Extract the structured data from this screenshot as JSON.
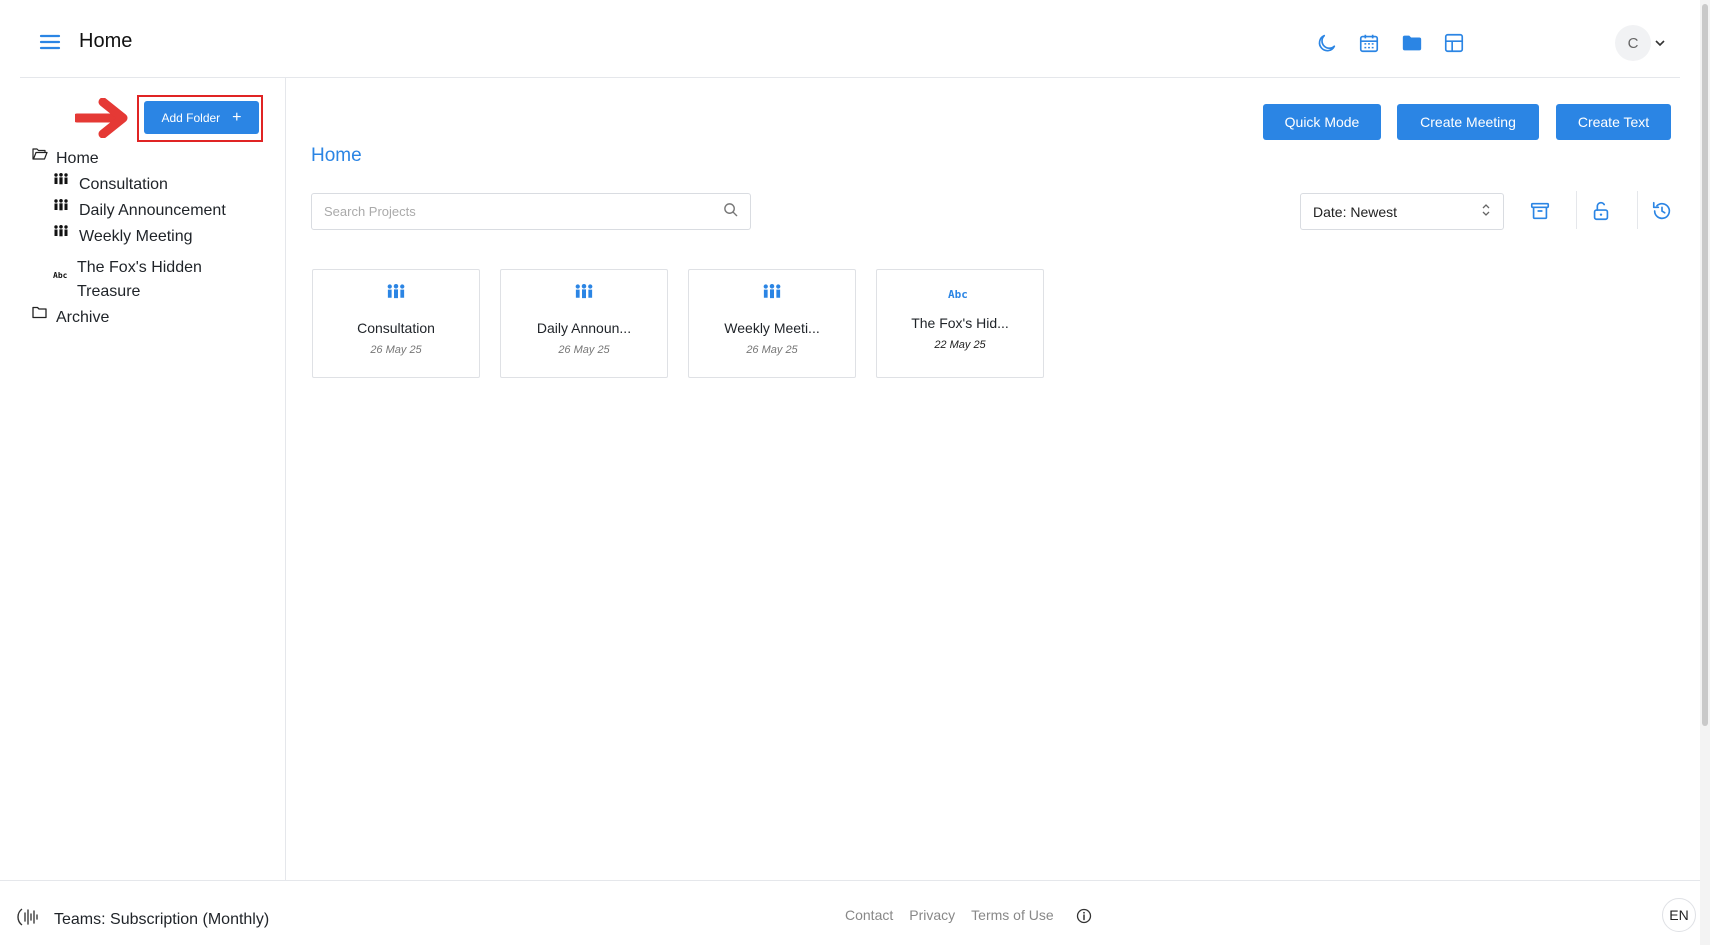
{
  "header": {
    "title": "Home",
    "avatar_initial": "C"
  },
  "sidebar": {
    "add_folder_label": "Add Folder",
    "add_folder_plus": "+",
    "tree": [
      {
        "label": "Home",
        "icon": "folder-open-icon"
      },
      {
        "label": "Consultation",
        "icon": "meeting-icon"
      },
      {
        "label": "Daily Announcement",
        "icon": "meeting-icon"
      },
      {
        "label": "Weekly Meeting",
        "icon": "meeting-icon"
      },
      {
        "label": "The Fox's Hidden Treasure",
        "icon": "text-abc-icon"
      },
      {
        "label": "Archive",
        "icon": "folder-icon"
      }
    ]
  },
  "main": {
    "buttons": {
      "quick_mode": "Quick Mode",
      "create_meeting": "Create Meeting",
      "create_text": "Create Text"
    },
    "breadcrumb": "Home",
    "search_placeholder": "Search Projects",
    "sort_value": "Date: Newest",
    "cards": [
      {
        "title": "Consultation",
        "date": "26 May 25",
        "type": "meeting"
      },
      {
        "title": "Daily Announ...",
        "date": "26 May 25",
        "type": "meeting"
      },
      {
        "title": "Weekly Meeti...",
        "date": "26 May 25",
        "type": "meeting"
      },
      {
        "title": "The Fox's Hid...",
        "date": "22 May 25",
        "type": "text"
      }
    ]
  },
  "footer": {
    "subscription": "Teams: Subscription (Monthly)",
    "links": [
      "Contact",
      "Privacy",
      "Terms of Use"
    ],
    "language": "EN"
  },
  "colors": {
    "accent": "#2b85e4",
    "highlight_outline": "#e02424"
  }
}
